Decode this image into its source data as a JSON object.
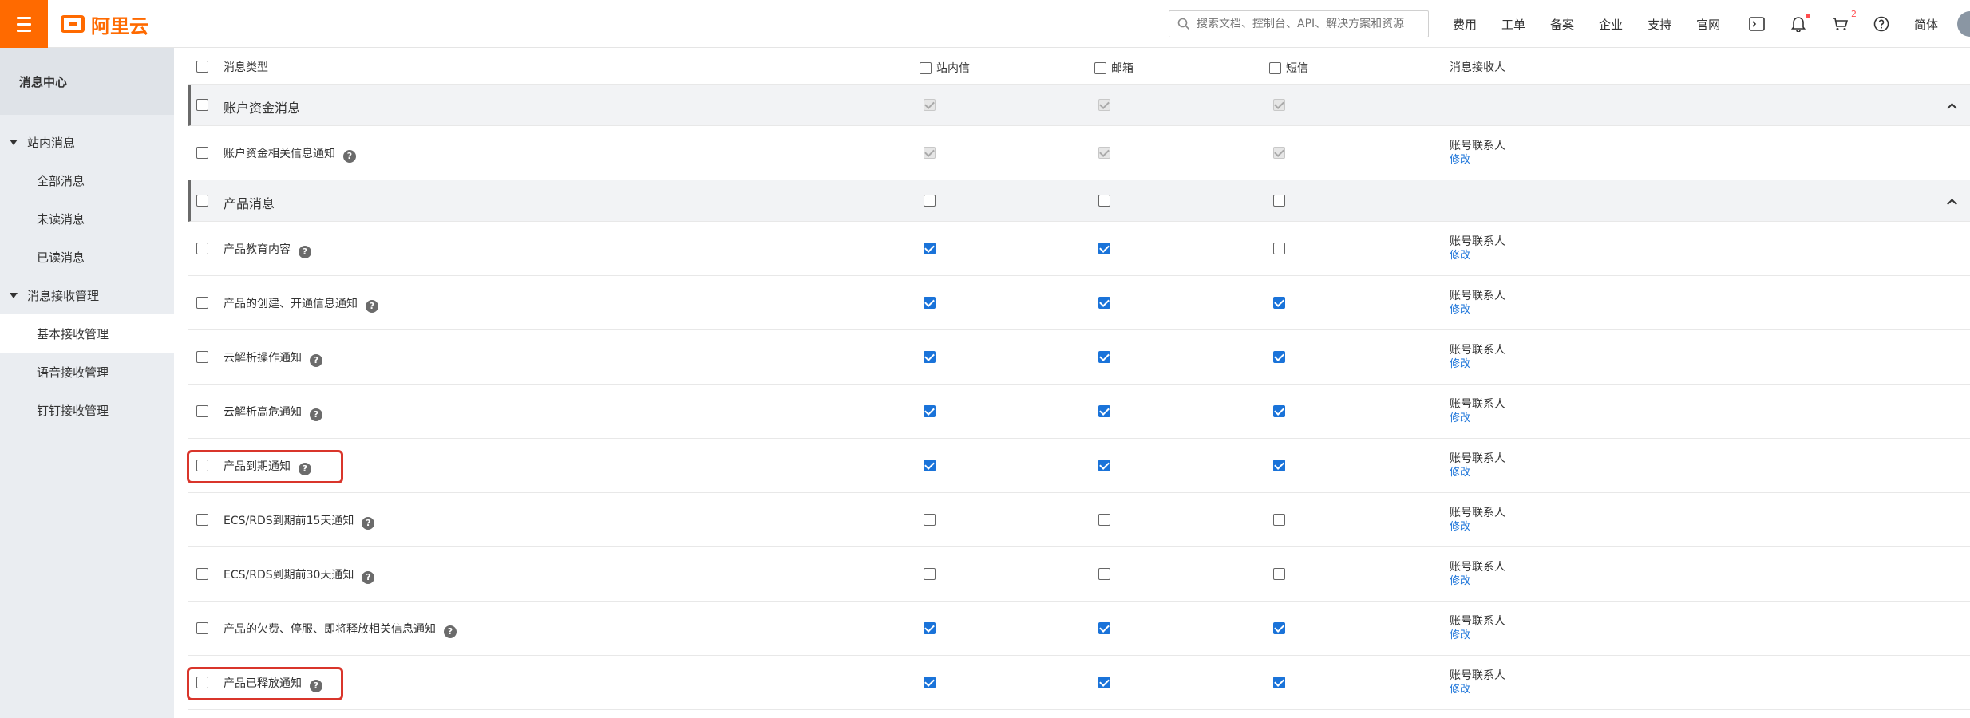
{
  "topbar": {
    "logo_text": "阿里云",
    "search_placeholder": "搜索文档、控制台、API、解决方案和资源",
    "nav_items": [
      "费用",
      "工单",
      "备案",
      "企业",
      "支持",
      "官网"
    ],
    "cart_badge": "2",
    "lang": "简体"
  },
  "sidebar": {
    "title": "消息中心",
    "group1": "站内消息",
    "group1_items": [
      "全部消息",
      "未读消息",
      "已读消息"
    ],
    "group2": "消息接收管理",
    "group2_items": [
      "基本接收管理",
      "语音接收管理",
      "钉钉接收管理"
    ]
  },
  "table": {
    "headers": {
      "type": "消息类型",
      "inbox": "站内信",
      "mail": "邮箱",
      "sms": "短信",
      "recipient": "消息接收人"
    },
    "rows": [
      {
        "kind": "group",
        "label": "账户资金消息",
        "inbox": "disabled",
        "mail": "disabled",
        "sms": "disabled",
        "recipient": ""
      },
      {
        "kind": "item",
        "label": "账户资金相关信息通知",
        "inbox": "disabled",
        "mail": "disabled",
        "sms": "disabled",
        "recipient": "账号联系人",
        "edit": "修改"
      },
      {
        "kind": "group",
        "label": "产品消息",
        "inbox": "off",
        "mail": "off",
        "sms": "off",
        "recipient": ""
      },
      {
        "kind": "item",
        "label": "产品教育内容",
        "inbox": "on",
        "mail": "on",
        "sms": "off",
        "recipient": "账号联系人",
        "edit": "修改"
      },
      {
        "kind": "item",
        "label": "产品的创建、开通信息通知",
        "inbox": "on",
        "mail": "on",
        "sms": "on",
        "recipient": "账号联系人",
        "edit": "修改"
      },
      {
        "kind": "item",
        "label": "云解析操作通知",
        "inbox": "on",
        "mail": "on",
        "sms": "on",
        "recipient": "账号联系人",
        "edit": "修改"
      },
      {
        "kind": "item",
        "label": "云解析高危通知",
        "inbox": "on",
        "mail": "on",
        "sms": "on",
        "recipient": "账号联系人",
        "edit": "修改"
      },
      {
        "kind": "item",
        "label": "产品到期通知",
        "inbox": "on",
        "mail": "on",
        "sms": "on",
        "recipient": "账号联系人",
        "edit": "修改",
        "highlight": true
      },
      {
        "kind": "item",
        "label": "ECS/RDS到期前15天通知",
        "inbox": "off",
        "mail": "off",
        "sms": "off",
        "recipient": "账号联系人",
        "edit": "修改"
      },
      {
        "kind": "item",
        "label": "ECS/RDS到期前30天通知",
        "inbox": "off",
        "mail": "off",
        "sms": "off",
        "recipient": "账号联系人",
        "edit": "修改"
      },
      {
        "kind": "item",
        "label": "产品的欠费、停服、即将释放相关信息通知",
        "inbox": "on",
        "mail": "on",
        "sms": "on",
        "recipient": "账号联系人",
        "edit": "修改"
      },
      {
        "kind": "item",
        "label": "产品已释放通知",
        "inbox": "on",
        "mail": "on",
        "sms": "on",
        "recipient": "账号联系人",
        "edit": "修改",
        "highlight": true
      }
    ]
  },
  "colors": {
    "accent": "#ff6a00",
    "checkbox_checked": "#1a73d9",
    "highlight_border": "#d9352b",
    "link": "#1a73d9"
  }
}
